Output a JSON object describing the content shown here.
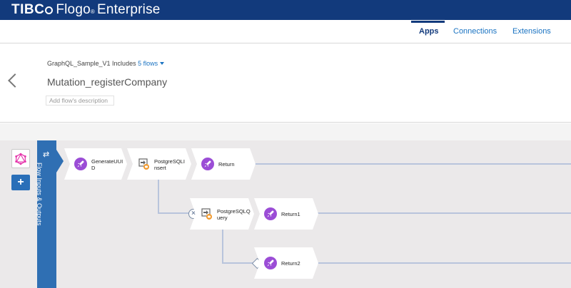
{
  "topbar": {
    "brand_tibco": "TIBC",
    "brand_flogo": "Flogo",
    "brand_reg": "®",
    "brand_product": "Enterprise"
  },
  "nav": {
    "apps": "Apps",
    "connections": "Connections",
    "extensions": "Extensions"
  },
  "header": {
    "app_name": "GraphQL_Sample_V1 Includes",
    "flows_link": "5 flows",
    "flow_title": "Mutation_registerCompany",
    "description_placeholder": "Add flow's description"
  },
  "sidebar": {
    "add_label": "+",
    "io_arrows": "⇄",
    "io_label": "Flow Inputs & Outputs"
  },
  "activities": {
    "generate_uuid": "GenerateUUI\nD",
    "pg_insert": "PostgreSQLI\nnsert",
    "return_main": "Return",
    "pg_query": "PostgreSQLQ\nuery",
    "return1": "Return1",
    "return2": "Return2"
  },
  "branch": {
    "error_symbol": "×"
  },
  "colors": {
    "header_blue": "#123a7c",
    "link_blue": "#1a73c2",
    "panel_blue": "#2f6fb3",
    "activity_purple": "#9b4dd6",
    "graphql_pink": "#e535ab"
  },
  "icons": {
    "trigger": "graphql-icon",
    "activity": "rocket-icon",
    "database": "database-icon"
  }
}
